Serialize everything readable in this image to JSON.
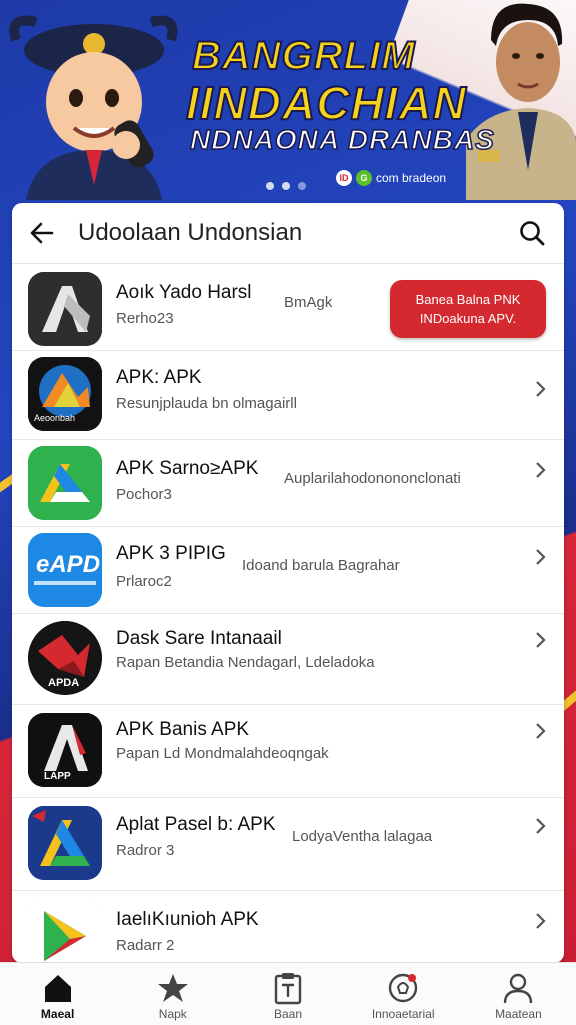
{
  "banner": {
    "title_line1": "BANGRLIM",
    "title_line2": "IINDACHIAN",
    "title_line3": "NDNAONA DRANBAS",
    "promo_text": "com bradeon",
    "promo_badge1": "ID",
    "promo_badge2": "G"
  },
  "header": {
    "title": "Udoolaan Undonsian"
  },
  "apps": [
    {
      "name": "Aoık Yado Harsl",
      "sub": "Rerho23",
      "mid": "BmAgk",
      "icon_label": ""
    },
    {
      "name": "APK: APK",
      "sub": "Resunjplauda bn olmagairll",
      "mid": "",
      "icon_label": "Aeoonbah"
    },
    {
      "name": "APK Sarno≥APK",
      "sub": "Pochor3",
      "mid": "Auplarilahodonononclonati",
      "icon_label": ""
    },
    {
      "name": "APK  3 PIPIG",
      "sub": "Prlaroc2",
      "mid": "Idoand barula Bagrahar",
      "icon_label": "eAPD"
    },
    {
      "name": "Dask Sare Intanaail",
      "sub": "Rapan Betandia Nendagarl, Ldeladoka",
      "mid": "",
      "icon_label": "APDA"
    },
    {
      "name": "APK Banis APK",
      "sub": "Papan Ld Mondmalahdeoqngak",
      "mid": "",
      "icon_label": "LAPP"
    },
    {
      "name": "Aplat Pasel b: APK",
      "sub": "Radror 3",
      "mid": "LodyaVentha lalagaa",
      "icon_label": ""
    },
    {
      "name": "IaelıKıunioh APK",
      "sub": "Radarr 2",
      "mid": "",
      "icon_label": ""
    }
  ],
  "cta": {
    "line1": "Banea Balna PNK",
    "line2": "INDoakuna APV."
  },
  "nav": [
    {
      "label": "Maeal",
      "icon": "home-icon",
      "active": true
    },
    {
      "label": "Napk",
      "icon": "star-icon",
      "active": false
    },
    {
      "label": "Baan",
      "icon": "clipboard-icon",
      "active": false
    },
    {
      "label": "Innoaetarial",
      "icon": "notification-bulb-icon",
      "active": false
    },
    {
      "label": "Maatean",
      "icon": "profile-icon",
      "active": false
    }
  ],
  "colors": {
    "accent_red": "#d42a2f",
    "banner_blue": "#2346c0",
    "title_yellow": "#f7d21a"
  }
}
